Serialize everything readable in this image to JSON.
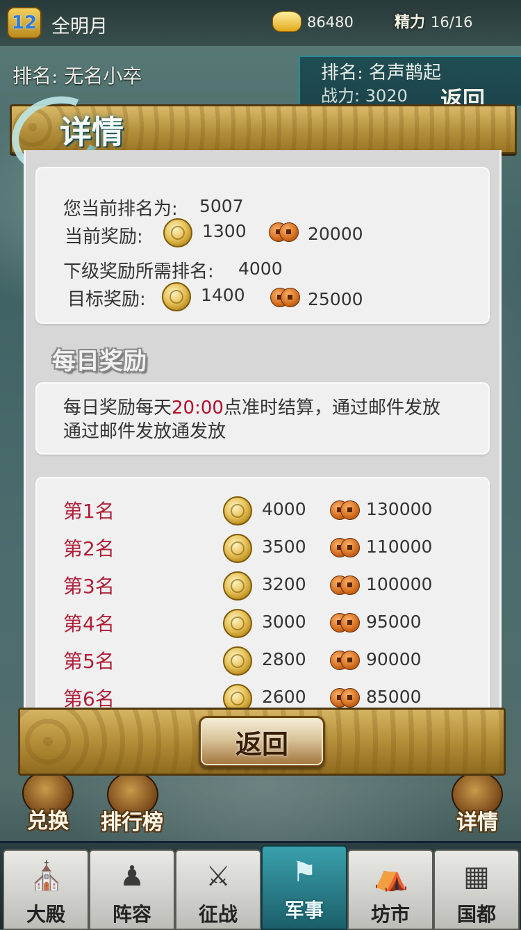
{
  "topbar": {
    "level": "12",
    "player_name": "全明月",
    "gold": "86480",
    "stamina_icon": "精力",
    "stamina": "16/16"
  },
  "background": {
    "my_rank": "排名: 无名小卒",
    "opponent_rank": "排名: 名声鹊起",
    "opponent_power": "战力: 3020",
    "return_label": "返回"
  },
  "dialog": {
    "title": "详情",
    "current_rank_label": "您当前排名为:",
    "current_rank": "5007",
    "current_reward_label": "当前奖励:",
    "current_reward_gold": "1300",
    "current_reward_copper": "20000",
    "next_rank_label": "下级奖励所需排名:",
    "next_rank": "4000",
    "target_reward_label": "目标奖励:",
    "target_reward_gold": "1400",
    "target_reward_copper": "25000",
    "daily_title": "每日奖励",
    "note_prefix": "每日奖励每天",
    "note_time": "20:00",
    "note_suffix": "点准时结算，通过邮件发放",
    "note_line2": "通过邮件发放通发放",
    "rewards": [
      {
        "rank": "第1名",
        "gold": "4000",
        "copper": "130000"
      },
      {
        "rank": "第2名",
        "gold": "3500",
        "copper": "110000"
      },
      {
        "rank": "第3名",
        "gold": "3200",
        "copper": "100000"
      },
      {
        "rank": "第4名",
        "gold": "3000",
        "copper": "95000"
      },
      {
        "rank": "第5名",
        "gold": "2800",
        "copper": "90000"
      },
      {
        "rank": "第6名",
        "gold": "2600",
        "copper": "85000"
      }
    ],
    "return_button": "返回"
  },
  "scene_buttons": {
    "exchange": "兑换",
    "leaderboard": "排行榜",
    "details": "详情"
  },
  "nav": {
    "tabs": [
      {
        "label": "大殿",
        "icon": "palace-icon"
      },
      {
        "label": "阵容",
        "icon": "warrior-icon"
      },
      {
        "label": "征战",
        "icon": "crossed-swords-icon"
      },
      {
        "label": "军事",
        "icon": "flag-icon"
      },
      {
        "label": "坊市",
        "icon": "market-icon"
      },
      {
        "label": "国都",
        "icon": "city-grid-icon"
      }
    ],
    "active": "军事"
  }
}
